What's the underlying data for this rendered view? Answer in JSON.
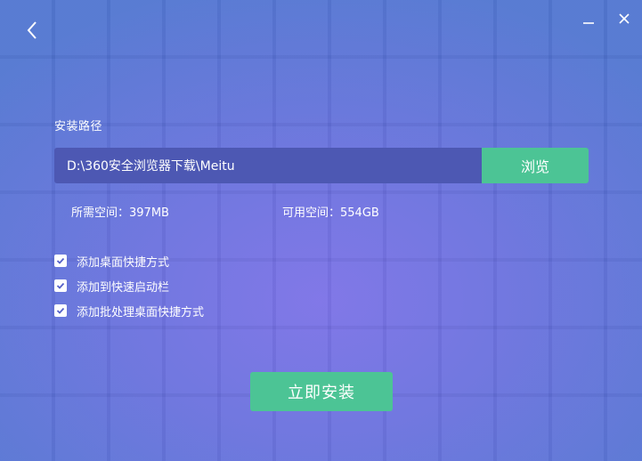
{
  "window": {
    "minimize_icon": "minimize-icon",
    "close_icon": "close-icon",
    "back_icon": "chevron-left-icon"
  },
  "install_path": {
    "label": "安装路径",
    "value": "D:\\360安全浏览器下载\\Meitu",
    "browse_label": "浏览"
  },
  "space": {
    "required": "所需空间：397MB",
    "available": "可用空间：554GB"
  },
  "options": [
    {
      "label": "添加桌面快捷方式",
      "checked": true
    },
    {
      "label": "添加到快速启动栏",
      "checked": true
    },
    {
      "label": "添加批处理桌面快捷方式",
      "checked": true
    }
  ],
  "install_button": "立即安装",
  "colors": {
    "accent_green": "#4cc495",
    "input_bg": "#4d58b3",
    "checkbox_check": "#5560c8"
  }
}
